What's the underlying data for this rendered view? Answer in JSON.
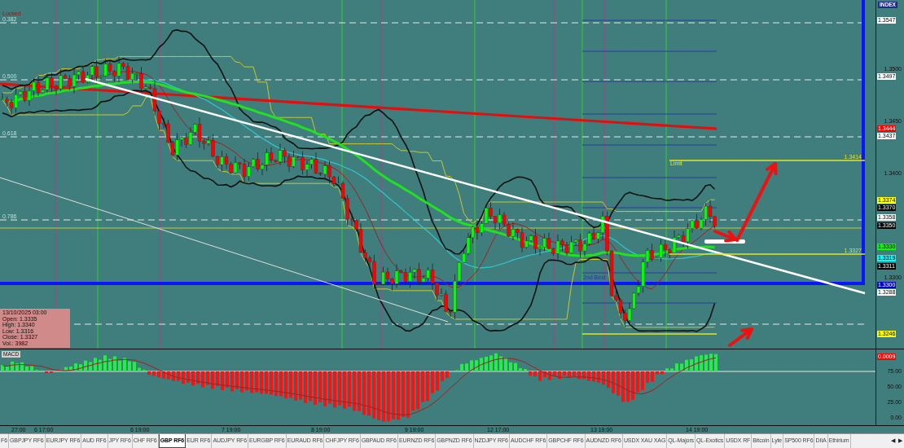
{
  "chart_labels": {
    "locked": "Locked",
    "fib_levels": [
      "0.382",
      "0.500",
      "0.618",
      "0.786"
    ],
    "limit": "Limit",
    "limit_price": "1.3414",
    "lower_price": "1.3327",
    "entry": "2nd Best"
  },
  "info_box": {
    "date": "13/10/2025 03:00",
    "lines": [
      "Open: 1.3335",
      "High: 1.3340",
      "Low: 1.3316",
      "Close: 1.3327",
      "Vol.: 3982"
    ]
  },
  "price_axis": {
    "index_label": "INDEX",
    "ticks": [
      "1.3500",
      "1.3450",
      "1.3400",
      "1.3300"
    ],
    "markers": [
      {
        "text": "1.3547",
        "color": "#ffffff"
      },
      {
        "text": "1.3497",
        "color": "#ffffff"
      },
      {
        "text": "1.3444",
        "color": "#ff0000"
      },
      {
        "text": "1.3437",
        "color": "#ffffff"
      },
      {
        "text": "1.3374",
        "color": "#ffff00"
      },
      {
        "text": "1.3370",
        "color": "#000000"
      },
      {
        "text": "1.3358",
        "color": "#ffffff"
      },
      {
        "text": "1.3350",
        "color": "#000000"
      },
      {
        "text": "1.3330",
        "color": "#00ff00"
      },
      {
        "text": "1.3319",
        "color": "#00ffff"
      },
      {
        "text": "1.3311",
        "color": "#000000"
      },
      {
        "text": "1.3300",
        "color": "#0000cc"
      },
      {
        "text": "1.3288",
        "color": "#ffffff"
      },
      {
        "text": "1.3246",
        "color": "#ffff00"
      }
    ]
  },
  "macd": {
    "title": "MACD",
    "marker": {
      "text": "0.0009",
      "color": "#ff0000"
    },
    "ticks": [
      "75.00",
      "50.00",
      "25.00",
      "0.00"
    ]
  },
  "time_axis": [
    "27:00",
    "6 17:00",
    "6 19:00",
    "7 19:00",
    "8 19:00",
    "9 19:00",
    "12 17:00",
    "13 19:00",
    "14 19:00"
  ],
  "tabs": [
    {
      "label": "F6",
      "selected": false
    },
    {
      "label": "GBPJPY RF6",
      "selected": false
    },
    {
      "label": "EURJPY RF6",
      "selected": false
    },
    {
      "label": "AUD RF6",
      "selected": false
    },
    {
      "label": "JPY RF6",
      "selected": false
    },
    {
      "label": "CHF RF6",
      "selected": false
    },
    {
      "label": "GBP RF6",
      "selected": true
    },
    {
      "label": "EUR RF6",
      "selected": false
    },
    {
      "label": "AUDJPY RF6",
      "selected": false
    },
    {
      "label": "EURGBP RF6",
      "selected": false
    },
    {
      "label": "EURAUD RF6",
      "selected": false
    },
    {
      "label": "CHFJPY RF6",
      "selected": false
    },
    {
      "label": "GBPAUD RF6",
      "selected": false
    },
    {
      "label": "EURNZD RF6",
      "selected": false
    },
    {
      "label": "GBPNZD RF6",
      "selected": false
    },
    {
      "label": "NZDJPY RF6",
      "selected": false
    },
    {
      "label": "AUDCHF RF6",
      "selected": false
    },
    {
      "label": "GBPCHF RF6",
      "selected": false
    },
    {
      "label": "AUDNZD RF6",
      "selected": false
    },
    {
      "label": "USDX XAU XAG",
      "selected": false
    },
    {
      "label": "QL-Majors",
      "selected": false
    },
    {
      "label": "QL-Exotics",
      "selected": false
    },
    {
      "label": "USDX RF",
      "selected": false
    },
    {
      "label": "Bitcoin",
      "selected": false
    },
    {
      "label": "Lyte",
      "selected": false
    },
    {
      "label": "SP500 RF6",
      "selected": false
    },
    {
      "label": "DIIA",
      "selected": false
    },
    {
      "label": "Ethirium",
      "selected": false
    }
  ],
  "tab_scroll": [
    "◀",
    "▶"
  ]
}
